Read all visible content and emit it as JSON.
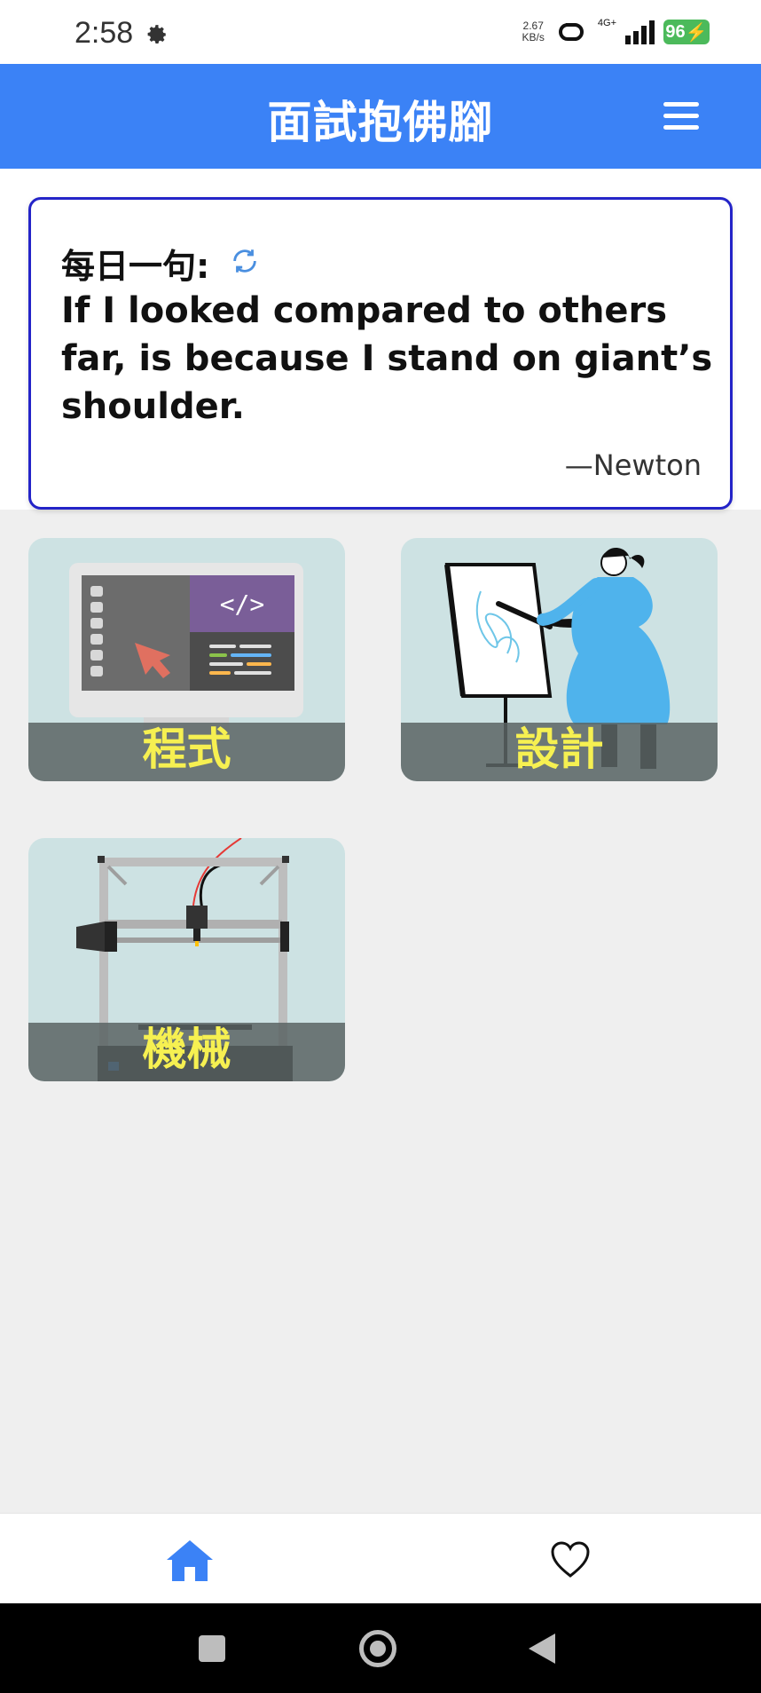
{
  "status_bar": {
    "time": "2:58",
    "speed_value": "2.67",
    "speed_unit": "KB/s",
    "network": "4G+",
    "battery": "96"
  },
  "app_bar": {
    "title": "面試抱佛腳",
    "menu_icon": "hamburger-menu-icon"
  },
  "daily_quote": {
    "label": "每日一句:",
    "refresh_icon": "refresh-icon",
    "text": "If I looked compared to others far, is because I stand on giant’s shoulder.",
    "author": "—Newton",
    "border_color": "#2424c8"
  },
  "categories": [
    {
      "label": "程式",
      "icon": "computer-code-illustration"
    },
    {
      "label": "設計",
      "icon": "painter-easel-illustration"
    },
    {
      "label": "機械",
      "icon": "3d-printer-illustration"
    }
  ],
  "bottom_nav": {
    "home_icon": "home-icon",
    "favorites_icon": "heart-icon",
    "active_color": "#3b82f6"
  },
  "colors": {
    "accent": "#3b82f6",
    "tile_label": "#f6f051"
  }
}
